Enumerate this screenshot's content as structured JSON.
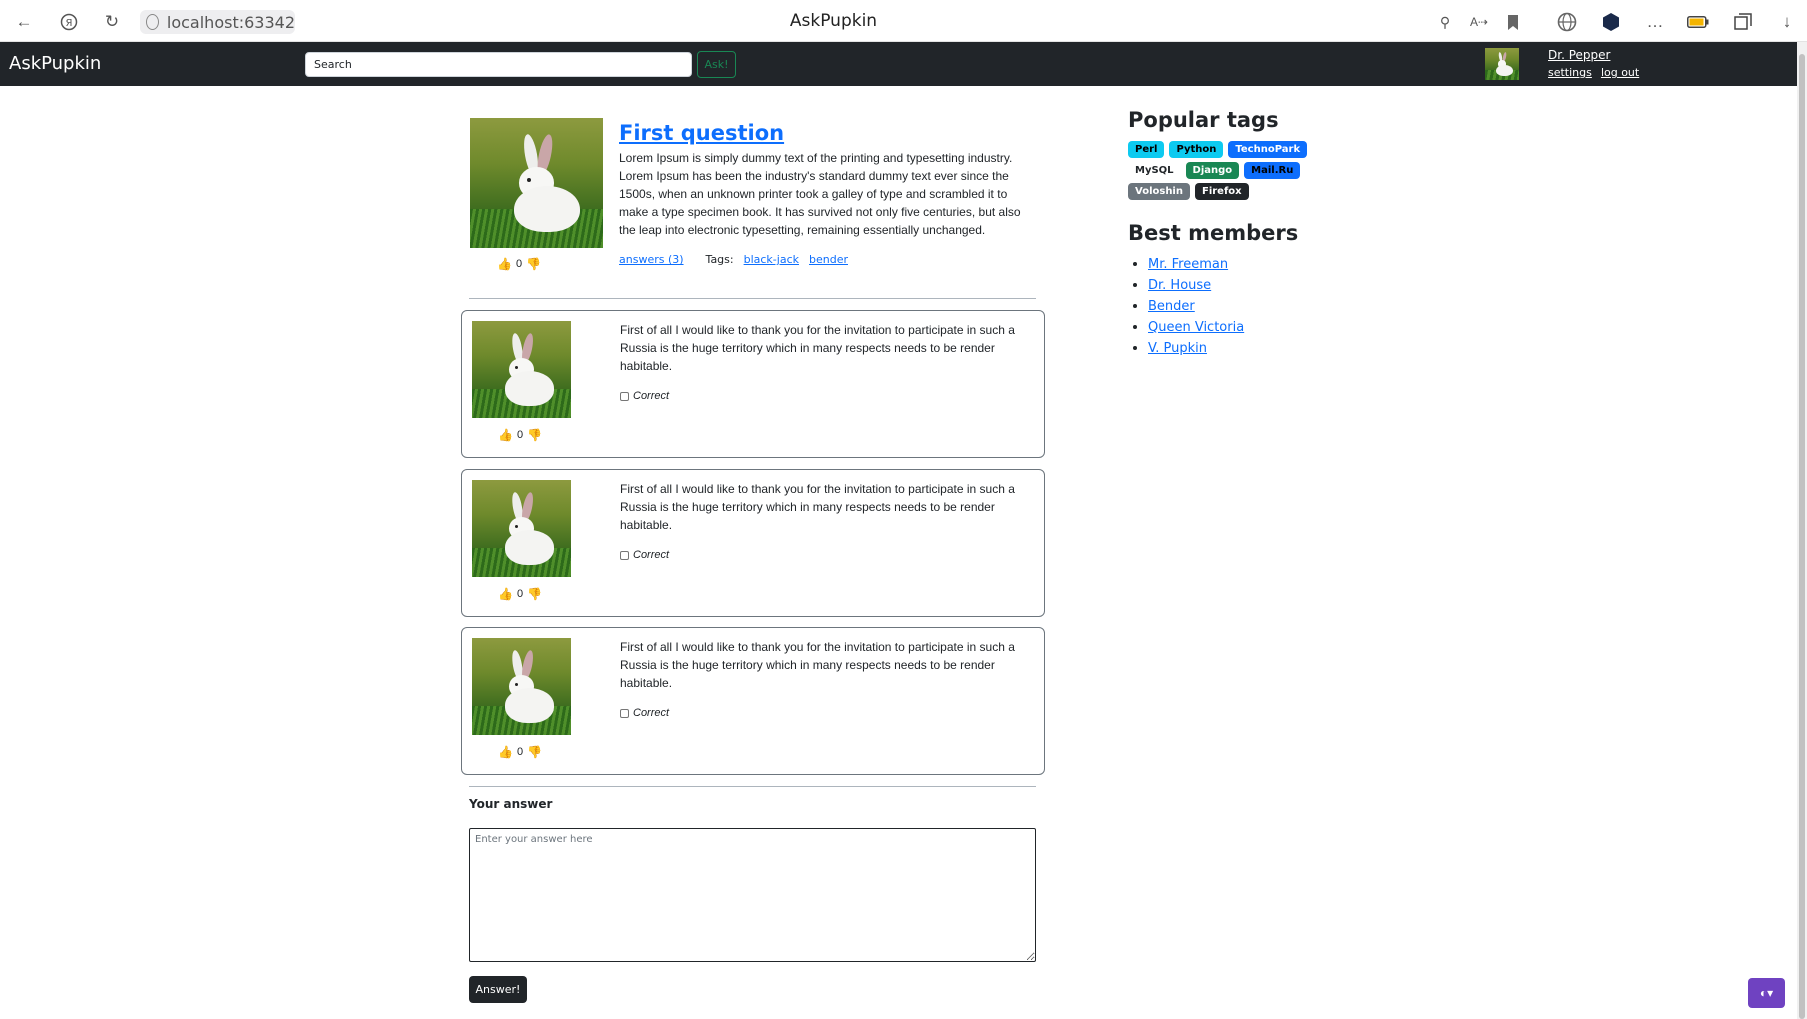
{
  "browser": {
    "url": "localhost:63342",
    "title": "AskPupkin",
    "icons": [
      "back-icon",
      "yandex-icon",
      "reload-icon",
      "site-info-icon",
      "reader-icon",
      "translate-icon",
      "bookmark-icon",
      "vpn-globe-icon",
      "extension-icon",
      "more-icon",
      "battery-icon",
      "collections-icon",
      "download-icon"
    ]
  },
  "navbar": {
    "brand": "AskPupkin",
    "search_placeholder": "Search",
    "ask_label": "Ask!",
    "user_name": "Dr. Pepper",
    "settings_label": "settings",
    "logout_label": "log out"
  },
  "question": {
    "title": "First question",
    "text": "Lorem Ipsum is simply dummy text of the printing and typesetting industry. Lorem Ipsum has been the industry's standard dummy text ever since the 1500s, when an unknown printer took a galley of type and scrambled it to make a type specimen book. It has survived not only five centuries, but also the leap into electronic typesetting, remaining essentially unchanged.",
    "votes": "0",
    "answers_link": "answers (3)",
    "tags_label": "Tags:",
    "tags": [
      "black-jack",
      "bender"
    ]
  },
  "answers": [
    {
      "text": "First of all I would like to thank you for the invitation to participate in such a Russia is the huge territory which in many respects needs to be render habitable.",
      "votes": "0",
      "correct_label": "Correct"
    },
    {
      "text": "First of all I would like to thank you for the invitation to participate in such a Russia is the huge territory which in many respects needs to be render habitable.",
      "votes": "0",
      "correct_label": "Correct"
    },
    {
      "text": "First of all I would like to thank you for the invitation to participate in such a Russia is the huge territory which in many respects needs to be render habitable.",
      "votes": "0",
      "correct_label": "Correct"
    }
  ],
  "answer_form": {
    "heading": "Your answer",
    "placeholder": "Enter your answer here",
    "submit_label": "Answer!"
  },
  "sidebar": {
    "popular_tags_title": "Popular tags",
    "tags": [
      {
        "label": "Perl",
        "bg": "#0dcaf0",
        "fg": "#000000"
      },
      {
        "label": "Python",
        "bg": "#0dcaf0",
        "fg": "#000000"
      },
      {
        "label": "TechnoPark",
        "bg": "#0d6efd",
        "fg": "#ffffff"
      },
      {
        "label": "MySQL",
        "bg": "#ffffff",
        "fg": "#212529"
      },
      {
        "label": "Django",
        "bg": "#198754",
        "fg": "#ffffff"
      },
      {
        "label": "Mail.Ru",
        "bg": "#0d6efd",
        "fg": "#000000"
      },
      {
        "label": "Voloshin",
        "bg": "#6c757d",
        "fg": "#ffffff"
      },
      {
        "label": "Firefox",
        "bg": "#212529",
        "fg": "#ffffff"
      }
    ],
    "best_members_title": "Best members",
    "members": [
      "Mr. Freeman",
      "Dr. House",
      "Bender",
      "Queen Victoria",
      "V. Pupkin"
    ]
  },
  "theme_toggle": "◐▾",
  "colors": {
    "navbar": "#212529",
    "link": "#0d6efd",
    "success": "#198754",
    "theme": "#6f42c1"
  }
}
